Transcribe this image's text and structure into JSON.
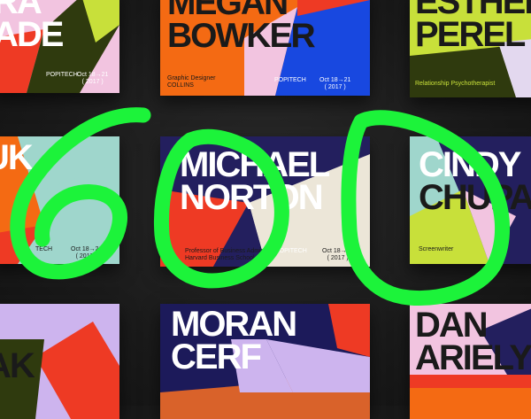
{
  "cards": {
    "c1": {
      "name_lines": [
        "RA",
        "ADE"
      ],
      "org": "POPITECH",
      "dates": [
        "Oct 18→21",
        "( 2017 )"
      ]
    },
    "c2": {
      "name_lines": [
        "MEGAN",
        "BOWKER"
      ],
      "role": "Graphic Designer",
      "affil": "COLLINS",
      "org": "POPITECH",
      "dates": [
        "Oct 18→21",
        "( 2017 )"
      ]
    },
    "c3": {
      "name_lines": [
        "ESTHER",
        "PEREL"
      ],
      "role": "Relationship Psychotherapist"
    },
    "c4": {
      "name_lines": [
        "UK"
      ],
      "org": "TECH",
      "dates": [
        "Oct 18→21",
        "( 2017 )"
      ]
    },
    "c5": {
      "name_lines": [
        "MICHAEL",
        "NORTON"
      ],
      "role": "Professor of Business Admin",
      "affil": "Harvard Business School",
      "org": "POPITECH",
      "dates": [
        "Oct 18→21",
        "( 2017 )"
      ]
    },
    "c6": {
      "name_lines": [
        "CINDY",
        "CHUPA"
      ],
      "role": "Screenwriter"
    },
    "c7": {
      "name_lines": [
        "AK"
      ]
    },
    "c8": {
      "name_lines": [
        "MORAN",
        "CERF"
      ]
    },
    "c9": {
      "name_lines": [
        "DAN",
        "ARIELY"
      ]
    }
  },
  "colors": {
    "marker": "#1cf33a",
    "background": "#1a1a1a",
    "pink": "#f2c4e0",
    "red": "#ee3a24",
    "orange": "#f46a13",
    "blue": "#1848e0",
    "navy": "#231f5e",
    "olive": "#2f3a0e",
    "lime": "#c8e03a",
    "mint": "#9fd6cc",
    "lilac": "#cdb4ee",
    "cream": "#ece6d8"
  },
  "overlay": {
    "icon": "handwritten-scribble",
    "drawn_numerals": "600"
  }
}
